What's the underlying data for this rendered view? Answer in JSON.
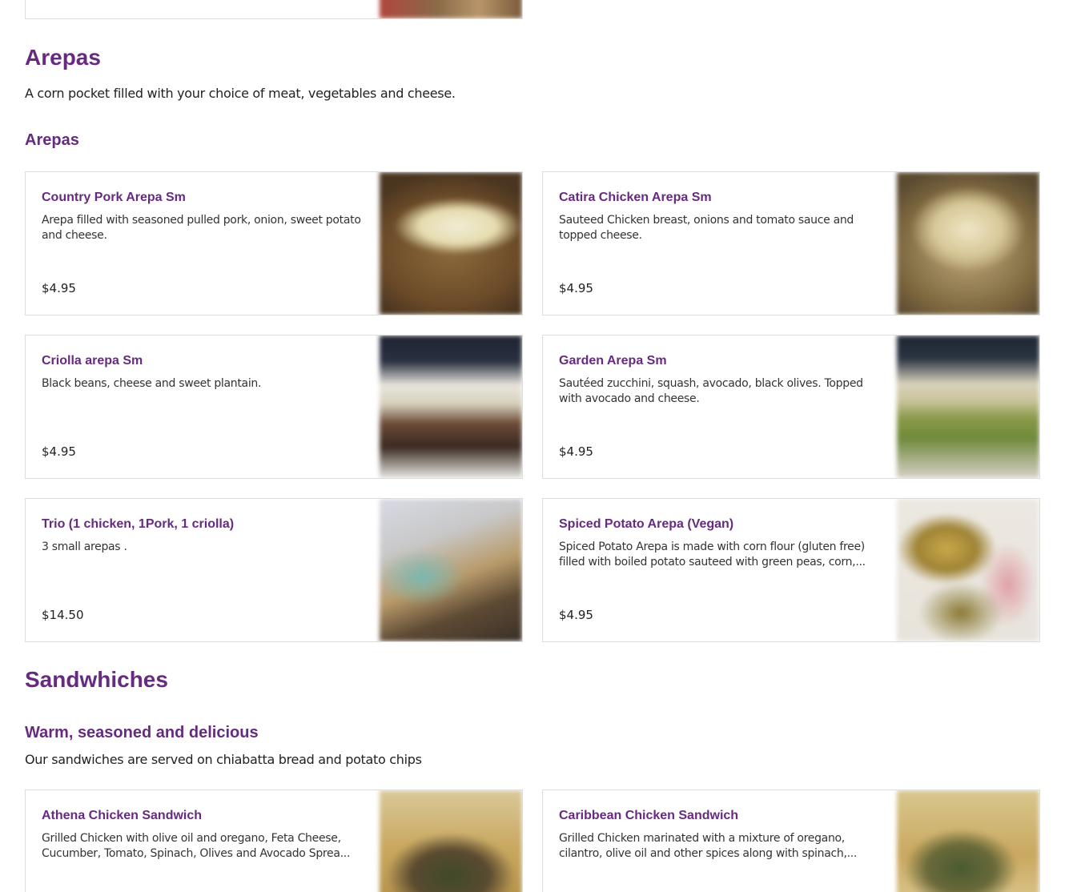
{
  "sections": [
    {
      "title": "Arepas",
      "description": "A corn pocket filled with your choice of meat, vegetables and cheese.",
      "subgroup": {
        "title": "Arepas",
        "description": ""
      },
      "items": [
        {
          "name": "Country Pork Arepa Sm",
          "description": "Arepa filled with seasoned pulled pork, onion, sweet potato and cheese.",
          "price": "$4.95"
        },
        {
          "name": "Catira Chicken Arepa Sm",
          "description": "Sauteed Chicken breast, onions and tomato sauce and topped cheese.",
          "price": "$4.95"
        },
        {
          "name": "Criolla arepa Sm",
          "description": "Black beans, cheese and sweet plantain.",
          "price": "$4.95"
        },
        {
          "name": "Garden Arepa Sm",
          "description": "Sautéed zucchini, squash, avocado, black olives. Topped with avocado and cheese.",
          "price": "$4.95"
        },
        {
          "name": "Trio (1 chicken, 1Pork, 1 criolla)",
          "description": "3 small arepas .",
          "price": "$14.50"
        },
        {
          "name": "Spiced Potato Arepa (Vegan)",
          "description": "Spiced Potato Arepa is made with corn flour (gluten free) filled with boiled potato sauteed with green peas, corn,...",
          "price": "$4.95"
        }
      ]
    },
    {
      "title": "Sandwhiches",
      "subgroup": {
        "title": "Warm, seasoned and delicious",
        "description": "Our sandwiches are served on chiabatta bread and potato chips"
      },
      "items": [
        {
          "name": "Athena Chicken Sandwich",
          "description": "Grilled Chicken with olive oil and oregano, Feta Cheese, Cucumber, Tomato, Spinach, Olives and Avocado Sprea...",
          "price": ""
        },
        {
          "name": "Caribbean Chicken Sandwich",
          "description": "Grilled Chicken marinated with a mixture of oregano, cilantro, olive oil and other spices along with spinach,...",
          "price": ""
        }
      ]
    }
  ],
  "colors": {
    "accent": "#662a80",
    "border": "#dcdcdc",
    "text": "#222222"
  }
}
